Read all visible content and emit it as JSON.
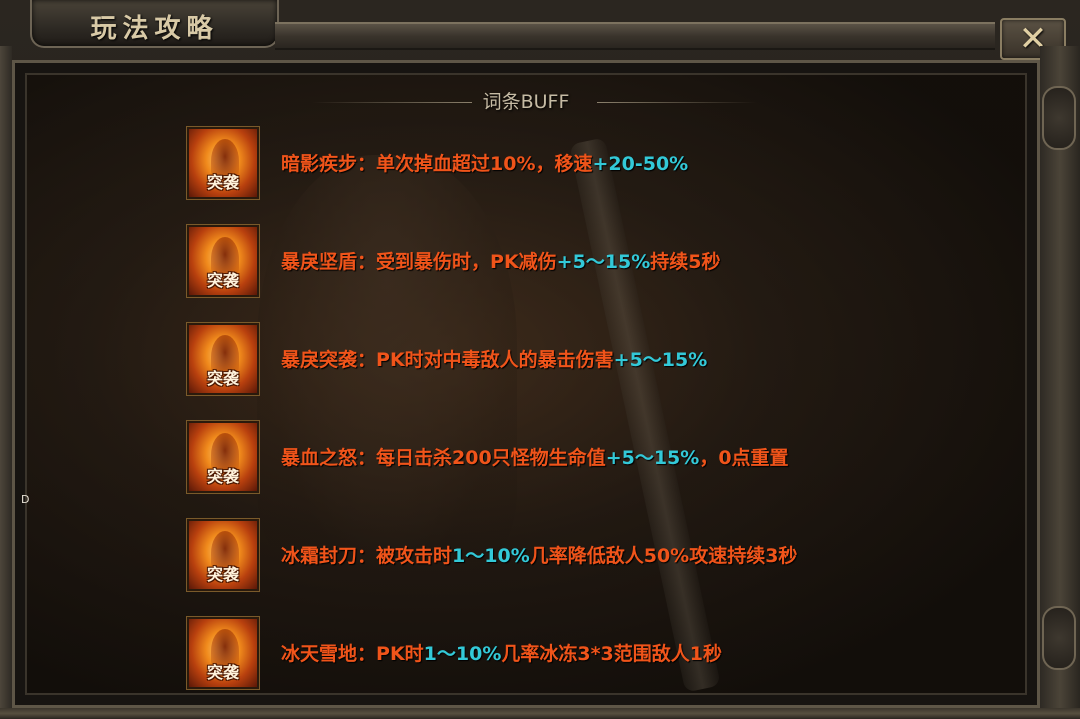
{
  "window": {
    "title": "玩法攻略",
    "close_symbol": "✕"
  },
  "section": {
    "title": "词条BUFF"
  },
  "buff_icon_label": "突袭",
  "edge_marker": "D",
  "colors": {
    "name": "#f0541a",
    "highlight": "#33c9d8",
    "header": "#c6bba4"
  },
  "buffs": [
    {
      "name": "暗影疾步：",
      "parts": [
        "单次掉血超过10%，移速",
        "+20-50%",
        ""
      ]
    },
    {
      "name": "暴戾坚盾：",
      "parts": [
        "受到暴伤时，PK减伤",
        "+5～15%",
        "持续5秒"
      ]
    },
    {
      "name": "暴戾突袭：",
      "parts": [
        "PK时对中毒敌人的暴击伤害",
        "+5～15%",
        ""
      ]
    },
    {
      "name": "暴血之怒：",
      "parts": [
        "每日击杀200只怪物生命值",
        "+5～15%",
        "，0点重置"
      ]
    },
    {
      "name": "冰霜封刀：",
      "parts": [
        "被攻击时",
        "1～10%",
        "几率降低敌人50%攻速持续3秒"
      ]
    },
    {
      "name": "冰天雪地：",
      "parts": [
        "PK时",
        "1～10%",
        "几率冰冻3*3范围敌人1秒"
      ]
    }
  ]
}
